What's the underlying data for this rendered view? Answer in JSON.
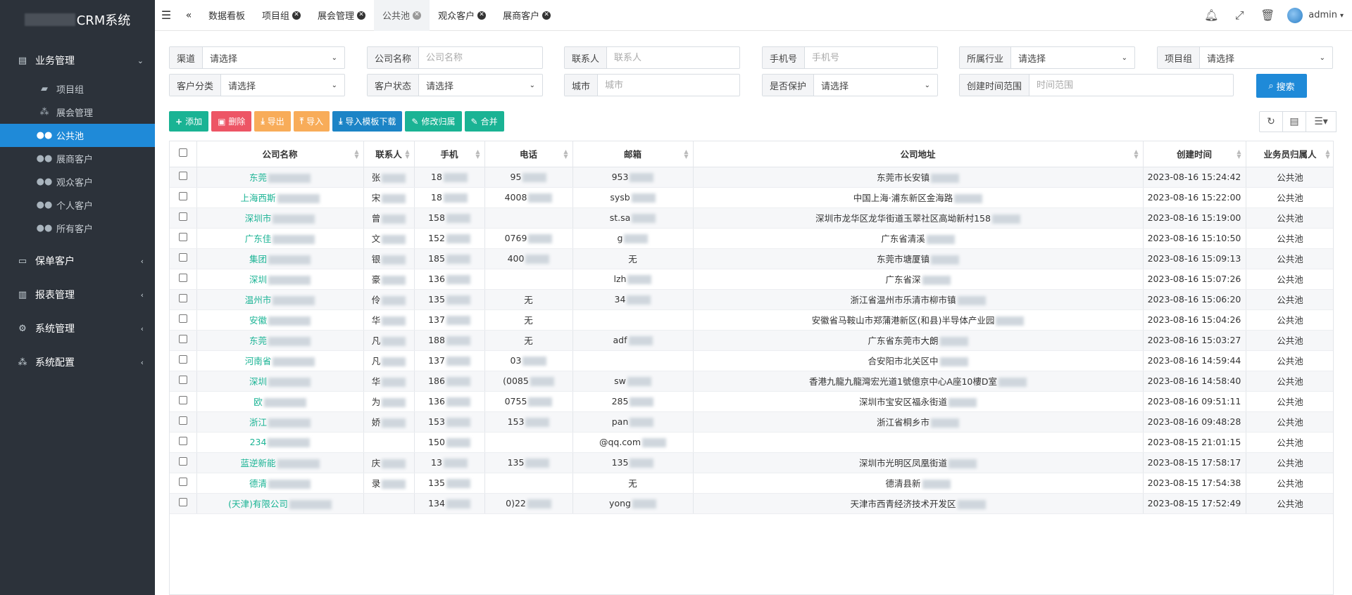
{
  "app": {
    "title": "CRM系统"
  },
  "sidebar": {
    "groups": [
      {
        "label": "业务管理",
        "icon": "building-icon",
        "expanded": true,
        "items": [
          {
            "label": "项目组",
            "icon": "book-icon"
          },
          {
            "label": "展会管理",
            "icon": "cubes-icon"
          },
          {
            "label": "公共池",
            "icon": "users-icon",
            "active": true
          },
          {
            "label": "展商客户",
            "icon": "users-icon"
          },
          {
            "label": "观众客户",
            "icon": "users-icon"
          },
          {
            "label": "个人客户",
            "icon": "users-icon"
          },
          {
            "label": "所有客户",
            "icon": "users-icon"
          }
        ]
      },
      {
        "label": "保单客户",
        "icon": "hdd-icon"
      },
      {
        "label": "报表管理",
        "icon": "map-icon"
      },
      {
        "label": "系统管理",
        "icon": "gear-icon"
      },
      {
        "label": "系统配置",
        "icon": "cubes-icon"
      }
    ]
  },
  "topbar": {
    "tabs": [
      {
        "label": "数据看板",
        "closable": false
      },
      {
        "label": "项目组",
        "closable": true
      },
      {
        "label": "展会管理",
        "closable": true
      },
      {
        "label": "公共池",
        "closable": true,
        "active": true
      },
      {
        "label": "观众客户",
        "closable": true
      },
      {
        "label": "展商客户",
        "closable": true
      }
    ],
    "user": "admin"
  },
  "filters": {
    "row1": [
      {
        "label": "渠道",
        "type": "select",
        "value": "请选择"
      },
      {
        "label": "公司名称",
        "type": "input",
        "placeholder": "公司名称"
      },
      {
        "label": "联系人",
        "type": "input",
        "placeholder": "联系人"
      },
      {
        "label": "手机号",
        "type": "input",
        "placeholder": "手机号"
      },
      {
        "label": "所属行业",
        "type": "select",
        "value": "请选择"
      },
      {
        "label": "项目组",
        "type": "select",
        "value": "请选择"
      }
    ],
    "row2": [
      {
        "label": "客户分类",
        "type": "select",
        "value": "请选择"
      },
      {
        "label": "客户状态",
        "type": "select",
        "value": "请选择"
      },
      {
        "label": "城市",
        "type": "input",
        "placeholder": "城市"
      },
      {
        "label": "是否保护",
        "type": "select",
        "value": "请选择"
      },
      {
        "label": "创建时间范围",
        "type": "input",
        "placeholder": "时间范围"
      }
    ],
    "search_label": "搜索"
  },
  "toolbar": {
    "add": "添加",
    "delete": "删除",
    "export": "导出",
    "import": "导入",
    "template": "导入模板下载",
    "modify_owner": "修改归属",
    "merge": "合并"
  },
  "table": {
    "columns": [
      "公司名称",
      "联系人",
      "手机",
      "电话",
      "邮箱",
      "公司地址",
      "创建时间",
      "业务员归属人"
    ],
    "rows": [
      [
        "东莞",
        "张",
        "18",
        "95",
        "953",
        "东莞市长安镇",
        "2023-08-16 15:24:42",
        "公共池"
      ],
      [
        "上海西斯",
        "宋",
        "18",
        "4008",
        "sysb",
        "中国上海·浦东新区金海路",
        "2023-08-16 15:22:00",
        "公共池"
      ],
      [
        "深圳市",
        "曾",
        "158",
        "",
        "st.sa",
        "深圳市龙华区龙华街道玉翠社区高坳新村158",
        "2023-08-16 15:19:00",
        "公共池"
      ],
      [
        "广东佳",
        "文",
        "152",
        "0769",
        "g",
        "广东省清溪",
        "2023-08-16 15:10:50",
        "公共池"
      ],
      [
        "集团",
        "银",
        "185",
        "400",
        "无",
        "东莞市塘厦镇",
        "2023-08-16 15:09:13",
        "公共池"
      ],
      [
        "深圳",
        "豪",
        "136",
        "",
        "lzh",
        "广东省深",
        "2023-08-16 15:07:26",
        "公共池"
      ],
      [
        "温州市",
        "伶",
        "135",
        "无",
        "34",
        "浙江省温州市乐清市柳市镇",
        "2023-08-16 15:06:20",
        "公共池"
      ],
      [
        "安徽",
        "华",
        "137",
        "无",
        "",
        "安徽省马鞍山市郑蒲港新区(和县)半导体产业园",
        "2023-08-16 15:04:26",
        "公共池"
      ],
      [
        "东莞",
        "凡",
        "188",
        "无",
        "adf",
        "广东省东莞市大朗",
        "2023-08-16 15:03:27",
        "公共池"
      ],
      [
        "河南省",
        "凡",
        "137",
        "03",
        "",
        "合安阳市北关区中",
        "2023-08-16 14:59:44",
        "公共池"
      ],
      [
        "深圳",
        "华",
        "186",
        "(0085",
        "sw",
        "香港九龍九龍灣宏光道1號億京中心A座10樓D室",
        "2023-08-16 14:58:40",
        "公共池"
      ],
      [
        "欧",
        "为",
        "136",
        "0755",
        "285",
        "深圳市宝安区福永街道",
        "2023-08-16 09:51:11",
        "公共池"
      ],
      [
        "浙江",
        "娇",
        "153",
        "153",
        "pan",
        "浙江省桐乡市",
        "2023-08-16 09:48:28",
        "公共池"
      ],
      [
        "234",
        "",
        "150",
        "",
        "@qq.com",
        "",
        "2023-08-15 21:01:15",
        "公共池"
      ],
      [
        "蓝逆新能",
        "庆",
        "13",
        "135",
        "135",
        "深圳市光明区凤凰街道",
        "2023-08-15 17:58:17",
        "公共池"
      ],
      [
        "德清",
        "录",
        "135",
        "",
        "无",
        "德清县新",
        "2023-08-15 17:54:38",
        "公共池"
      ],
      [
        "(天津)有限公司",
        "",
        "134",
        "0)22",
        "yong",
        "天津市西青经济技术开发区",
        "2023-08-15 17:52:49",
        "公共池"
      ]
    ]
  }
}
